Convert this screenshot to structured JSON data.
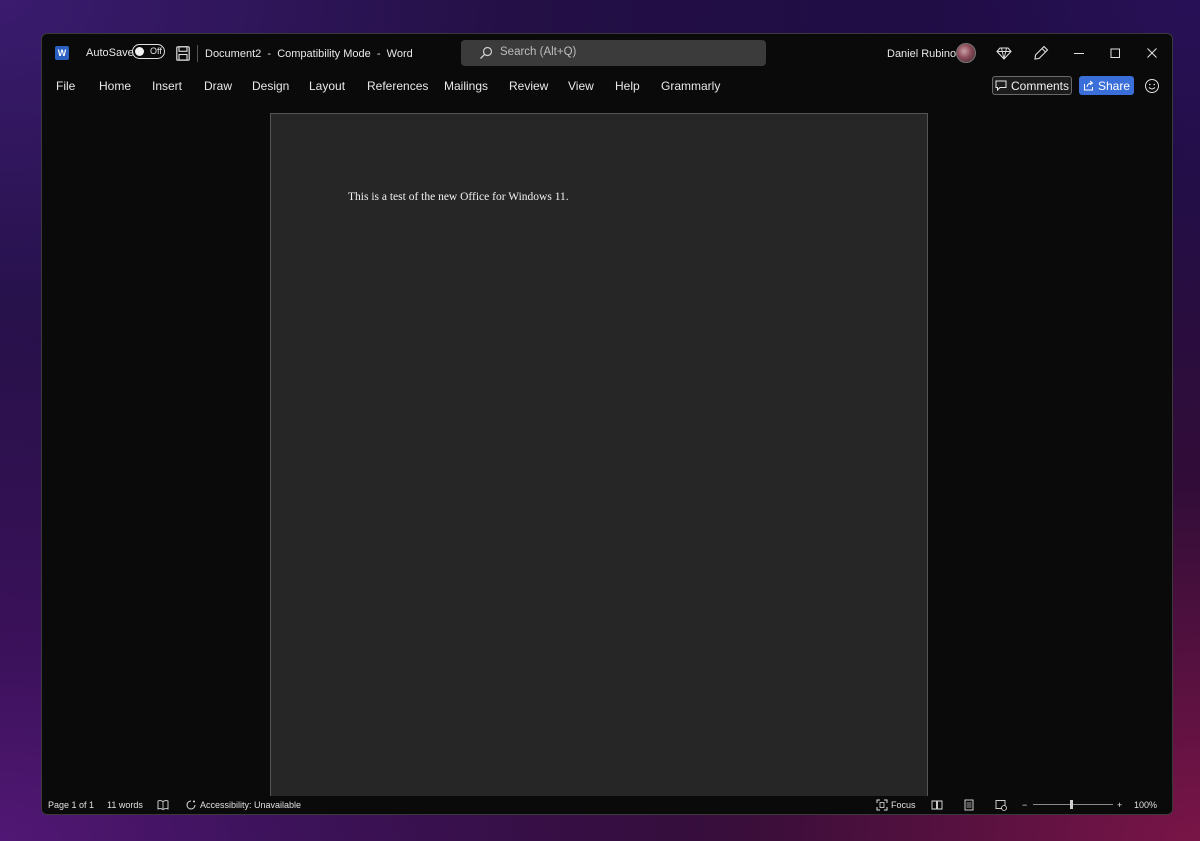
{
  "titlebar": {
    "app_icon_letter": "W",
    "autosave_label": "AutoSave",
    "autosave_state": "Off",
    "document_name": "Document2",
    "compat_mode": "Compatibility Mode",
    "app_name": "Word",
    "separator": "-",
    "search_placeholder": "Search (Alt+Q)",
    "user_name": "Daniel Rubino"
  },
  "ribbon": {
    "tabs": [
      "File",
      "Home",
      "Insert",
      "Draw",
      "Design",
      "Layout",
      "References",
      "Mailings",
      "Review",
      "View",
      "Help",
      "Grammarly"
    ],
    "comments_label": "Comments",
    "share_label": "Share"
  },
  "document": {
    "body_text": "This is a test of the new Office for Windows 11."
  },
  "statusbar": {
    "page_info": "Page 1 of 1",
    "word_count": "11 words",
    "accessibility": "Accessibility: Unavailable",
    "focus_label": "Focus",
    "zoom_minus": "−",
    "zoom_plus": "+",
    "zoom_level": "100%"
  },
  "colors": {
    "accent": "#3a6ed8",
    "word_brand": "#2b5fc2",
    "page_bg": "#262626",
    "window_bg": "#0a0a0a"
  }
}
